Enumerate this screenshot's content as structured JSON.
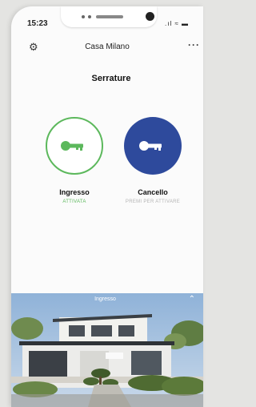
{
  "status_bar": {
    "time": "15:23",
    "icons": ".ıl ≈ ▬"
  },
  "header": {
    "title": "Casa Milano"
  },
  "section_title": "Serrature",
  "locks": [
    {
      "name": "Ingresso",
      "status": "ATTIVATA",
      "status_color": "#5cb85c",
      "circle_color": "#ffffff",
      "key_color": "#5cb85c"
    },
    {
      "name": "Cancello",
      "status": "PREMI PER ATTIVARE",
      "status_color": "#b5b5b5",
      "circle_color": "#2e4a9c",
      "key_color": "#ffffff"
    }
  ],
  "photo": {
    "caption": "Ingresso"
  },
  "icons": {
    "settings": "gear-icon",
    "more": "more-icon",
    "key": "key-icon",
    "collapse": "chevron-up-icon"
  },
  "colors": {
    "accent_green": "#5cb85c",
    "accent_blue": "#2e4a9c"
  }
}
